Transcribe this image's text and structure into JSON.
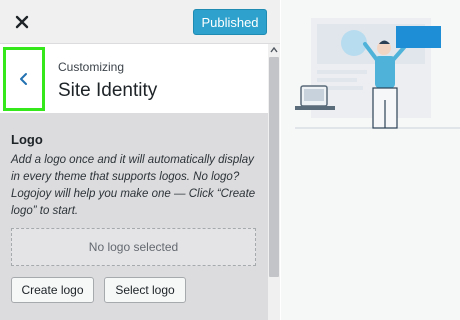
{
  "topbar": {
    "close_icon": "close-icon",
    "publish_label": "Published",
    "publish_color": "#2ea2cc"
  },
  "section": {
    "back_icon": "chevron-left-icon",
    "customizing_label": "Customizing",
    "title": "Site Identity",
    "highlight_color": "#34e81b"
  },
  "logo": {
    "heading": "Logo",
    "description": "Add a logo once and it will automatically display in every theme that supports logos. No logo? Logojoy will help you make one — Click “Create logo” to start.",
    "placeholder": "No logo selected",
    "create_label": "Create logo",
    "select_label": "Select logo"
  },
  "preview": {
    "accent_color": "#1e8fd6",
    "figure_color": "#4fb3d9"
  }
}
